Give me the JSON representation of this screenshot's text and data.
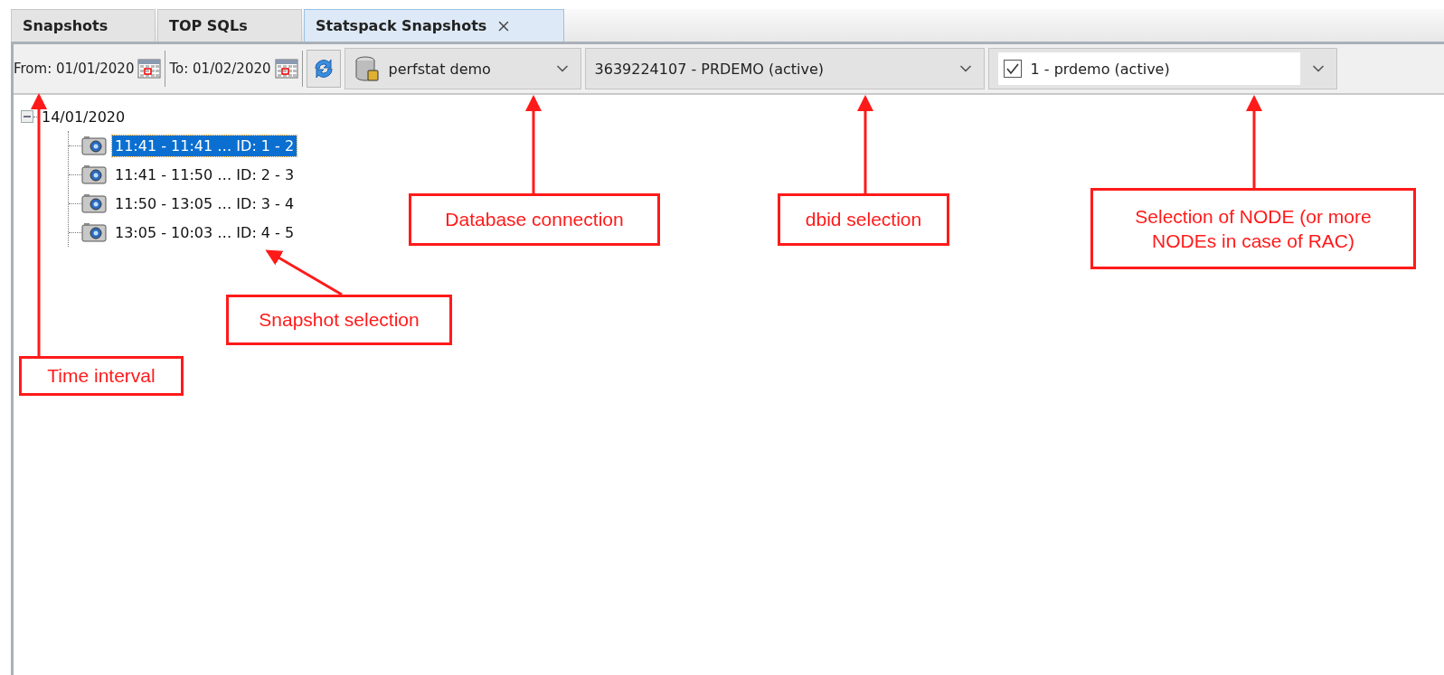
{
  "tabs": [
    {
      "label": "Snapshots",
      "selected": false,
      "closable": false
    },
    {
      "label": "TOP SQLs",
      "selected": false,
      "closable": false
    },
    {
      "label": "Statspack Snapshots",
      "selected": true,
      "closable": true
    }
  ],
  "toolbar": {
    "from": "From: 01/01/2020",
    "to": "To: 01/02/2020",
    "connection": "perfstat demo",
    "dbid": "3639224107 - PRDEMO (active)",
    "node": {
      "label": "1 - prdemo (active)",
      "checked": true
    }
  },
  "tree": {
    "label": "14/01/2020",
    "expanded": true,
    "children": [
      {
        "label": "11:41 - 11:41 … ID: 1 - 2",
        "selected": true
      },
      {
        "label": "11:41 - 11:50 … ID: 2 - 3",
        "selected": false
      },
      {
        "label": "11:50 - 13:05 … ID: 3 - 4",
        "selected": false
      },
      {
        "label": "13:05 - 10:03 … ID: 4 - 5",
        "selected": false
      }
    ]
  },
  "annotations": [
    "Database connection",
    "dbid selection",
    "Selection of NODE (or more NODEs in case of RAC)",
    "Snapshot selection",
    "Time interval"
  ]
}
